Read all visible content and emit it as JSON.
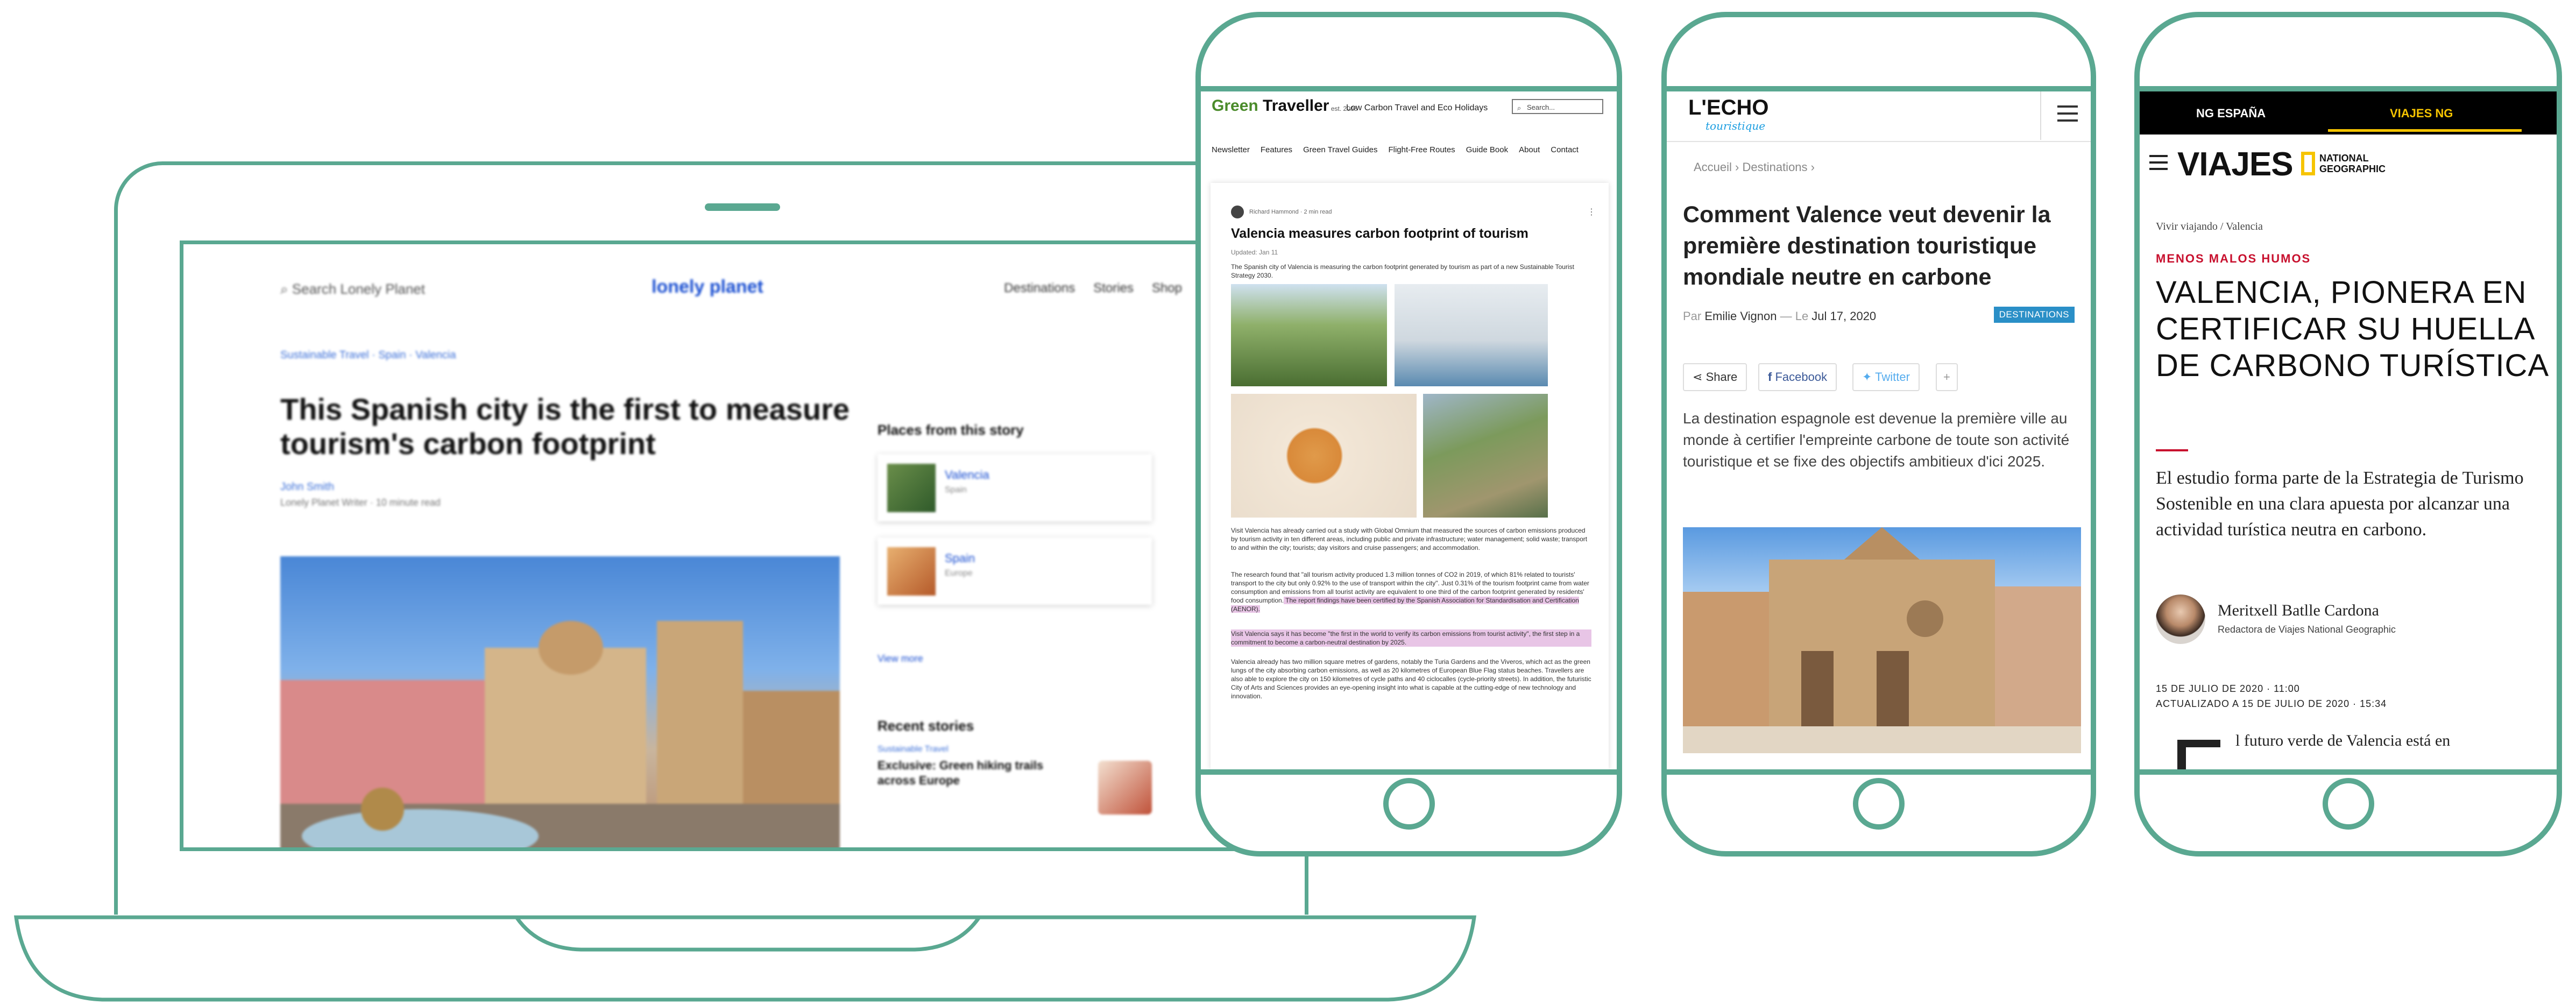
{
  "laptop": {
    "search_label": "Search Lonely Planet",
    "logo": "lonely planet",
    "nav": [
      "Destinations",
      "Stories",
      "Shop"
    ],
    "breadcrumb": "Sustainable Travel · Spain · Valencia",
    "title": "This Spanish city is the first to measure tourism's carbon footprint",
    "author": "John Smith",
    "meta": "Lonely Planet Writer · 10 minute read",
    "places_heading": "Places from this story",
    "places": [
      {
        "name": "Valencia",
        "sub": "Spain"
      },
      {
        "name": "Spain",
        "sub": "Europe"
      }
    ],
    "view_all": "View more",
    "recent_heading": "Recent stories",
    "recent_tag": "Sustainable Travel",
    "recent_title": "Exclusive: Green hiking trails across Europe"
  },
  "green_traveller": {
    "logo_a": "Green",
    "logo_b": " Traveller",
    "logo_est": " est. 2006",
    "tagline": "Low Carbon Travel and Eco Holidays",
    "search_placeholder": "Search...",
    "search_icon": "search-icon",
    "nav": [
      "Newsletter",
      "Features",
      "Green Travel Guides",
      "Flight-Free Routes",
      "Guide Book",
      "About",
      "Contact"
    ],
    "author": "Richard Hammond · 2 min read",
    "title": "Valencia measures carbon footprint of tourism",
    "updated": "Updated: Jan 11",
    "lead": "The Spanish city of Valencia is measuring the carbon footprint generated by tourism as part of a new Sustainable Tourist Strategy 2030.",
    "p1": "Visit Valencia has already carried out a study with Global Omnium that measured the sources of carbon emissions produced by tourism activity in ten different areas, including public and private infrastructure; water management; solid waste; transport to and within the city; tourists; day visitors and cruise passengers; and accommodation.",
    "p2a": "The research found that \"all tourism activity produced 1.3 million tonnes of CO2 in 2019, of which 81% related to tourists' transport to the city but only 0.92% to the use of transport within the city\". Just 0.31% of the tourism footprint came from water consumption and emissions from all tourist activity are equivalent to one third of the carbon footprint generated by residents' food consumption.",
    "p2b": " The report findings have been certified by the Spanish Association for Standardisation and Certification (AENOR).",
    "p3": "Visit Valencia says it has become \"the first in the world to verify its carbon emissions from tourist activity\", the first step in a commitment to become a carbon-neutral destination by 2025.",
    "p4": "Valencia already has two million square metres of gardens, notably the Turia Gardens and the Viveros, which act as the green lungs of the city absorbing carbon emissions, as well as 20 kilometres of European Blue Flag status beaches. Travellers are also able to explore the city on 150 kilometres of cycle paths and 40 ciclocalles (cycle-priority streets). In addition, the futuristic City of Arts and Sciences provides an eye-opening insight into what is capable at the cutting-edge of new technology and innovation."
  },
  "lecho": {
    "logo": "L'ECHO",
    "logo_sub": "touristique",
    "breadcrumb": "Accueil  ›  Destinations  ›",
    "title": "Comment Valence veut devenir la première destination touristique mondiale neutre en carbone",
    "by_prefix": "Par ",
    "author": "Emilie Vignon",
    "date_prefix": "  —  Le ",
    "date": "Jul 17, 2020",
    "badge": "DESTINATIONS",
    "share": "Share",
    "facebook": "Facebook",
    "twitter": "Twitter",
    "more": "+",
    "lead": "La destination espagnole est devenue la première ville au monde à certifier l'empreinte carbone de toute son activité touristique et se fixe des objectifs ambitieux d'ici 2025."
  },
  "viajes": {
    "tab1": "NG ESPAÑA",
    "tab2": "VIAJES NG",
    "logo": "VIAJES",
    "natgeo_1": "NATIONAL",
    "natgeo_2": "GEOGRAPHIC",
    "breadcrumb": "Vivir viajando / Valencia",
    "kicker": "MENOS MALOS HUMOS",
    "title": "VALENCIA, PIONERA EN CERTIFICAR SU HUELLA DE CARBONO TURÍSTICA",
    "lead": "El estudio forma parte de la Estrategia de Turismo Sostenible en una clara apuesta por alcanzar una actividad turística neutra en carbono.",
    "author": "Meritxell Batlle Cardona",
    "role": "Redactora de Viajes National Geographic",
    "date1": "15 DE JULIO DE 2020 · 11:00",
    "date2": "ACTUALIZADO A 15 DE JULIO DE 2020 · 15:34",
    "body": "l futuro verde de Valencia está en"
  },
  "colors": {
    "frame": "#5aa891",
    "ng_yellow": "#f6c400",
    "ng_red": "#c8102e",
    "lecho_blue": "#2a8fc7",
    "highlight": "#e8c5e6"
  }
}
